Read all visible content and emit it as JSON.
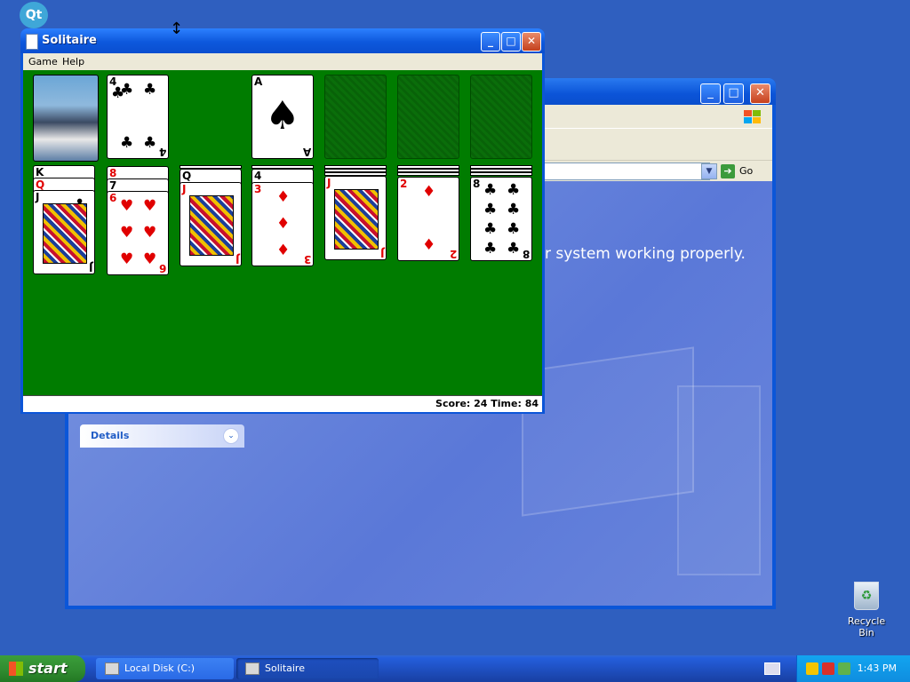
{
  "solitaire": {
    "title": "Solitaire",
    "menu": [
      "Game",
      "Help"
    ],
    "status": "Score: 24  Time: 84",
    "stock_top_rank": "4",
    "foundation_card": {
      "rank": "A",
      "suit": "♠"
    },
    "tableau": [
      {
        "ranks": [
          "K",
          "Q",
          "J"
        ],
        "suit": "♣"
      },
      {
        "ranks": [
          "8",
          "7",
          "6"
        ],
        "suit": "♥"
      },
      {
        "ranks": [
          "Q",
          "J"
        ],
        "suit": "♥"
      },
      {
        "ranks": [
          "4",
          "3"
        ],
        "suit": "♦"
      },
      {
        "ranks": [
          "J"
        ],
        "suit": "♦"
      },
      {
        "ranks": [
          "2"
        ],
        "suit": "♦"
      },
      {
        "ranks": [
          "8"
        ],
        "suit": "♣"
      }
    ]
  },
  "background_window": {
    "go_label": "Go",
    "content_text": "r system working properly.",
    "details_label": "Details"
  },
  "desktop": {
    "recycle_bin_label": "Recycle Bin",
    "qt_label": "Qt"
  },
  "taskbar": {
    "start_label": "start",
    "tasks": [
      "Local Disk (C:)",
      "Solitaire"
    ],
    "clock": "1:43 PM"
  },
  "icons": {
    "window": "window-icon",
    "flag": "windows-flag-icon",
    "bin": "recycle-bin-icon",
    "cursor": "resize-cursor-icon"
  },
  "colors": {
    "felt": "#007c00",
    "xp_blue": "#0b55d8",
    "start_green": "#2f8a2f"
  }
}
